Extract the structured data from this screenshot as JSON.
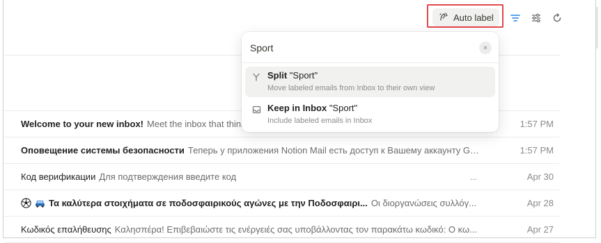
{
  "toolbar": {
    "auto_label": "Auto label",
    "icons": [
      "auto-label-icon",
      "list-density-icon",
      "filter-settings-icon",
      "refresh-icon"
    ]
  },
  "label_popup": {
    "search_value": "Sport",
    "clear_icon": "×",
    "options": [
      {
        "action": "Split",
        "target": "\"Sport\"",
        "description": "Move labeled emails from Inbox to their own view",
        "icon": "split-icon"
      },
      {
        "action": "Keep in Inbox",
        "target": "\"Sport\"",
        "description": "Include labeled emails in Inbox",
        "icon": "inbox-icon"
      }
    ]
  },
  "emails": [
    {
      "subject": "Welcome to your new inbox!",
      "preview": "Meet the inbox that thinks",
      "time": "1:57 PM",
      "bold": true,
      "dots": ""
    },
    {
      "subject": "Оповещение системы безопасности",
      "preview": "Теперь у приложения Notion Mail есть доступ к Вашему аккаунту Googl...",
      "time": "1:57 PM",
      "bold": true,
      "dots": ""
    },
    {
      "subject": "Код верификации",
      "preview": "Для подтверждения введите код",
      "time": "Apr 30",
      "bold": false,
      "dots": "..."
    },
    {
      "subject": "Τα καλύτερα στοιχήματα σε ποδοσφαιρικούς αγώνες με την Ποδοσφαιρι...",
      "preview": "Οι διοργανώσεις συλλόγ...",
      "time": "Apr 28",
      "bold": true,
      "dots": "",
      "emojis": [
        "soccer-ball-icon",
        "car-icon"
      ]
    },
    {
      "subject": "Κωδικός επαλήθευσης",
      "preview": "Καλησπέρα! Επιβεβαιώστε τις ενέργειές σας υποβάλλοντας τον παρακάτω κωδικό: Ο κω...",
      "time": "Apr 27",
      "bold": false,
      "dots": ""
    }
  ],
  "colors": {
    "highlight": "#e2474a",
    "accent": "#2383e2"
  }
}
